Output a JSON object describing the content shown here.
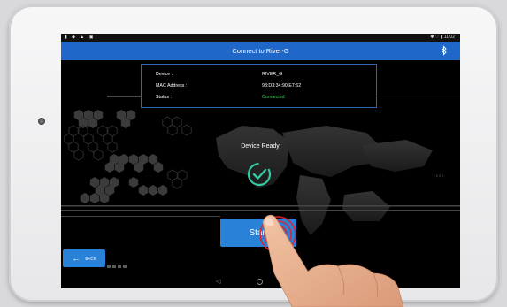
{
  "status_bar": {
    "left_icons": "▮ ◆ ▲ ▣",
    "time": "✱ ♡ ▮ 11:02"
  },
  "app_bar": {
    "title": "Connect to River-G"
  },
  "device_info": {
    "rows": [
      {
        "label": "Device :",
        "value": "RIVER_G"
      },
      {
        "label": "MAC Address :",
        "value": "98:D3:34:90:E7:62"
      },
      {
        "label": "Status :",
        "value": "Connected"
      }
    ]
  },
  "ready": {
    "title": "Device Ready"
  },
  "start_button": {
    "label": "Start"
  },
  "back_button": {
    "label": "BACK"
  },
  "decor": {
    "arrows": "››››"
  },
  "colors": {
    "accent": "#1f67c9",
    "button": "#2a82d8",
    "success": "#3bd35a",
    "check_ring": "#34c9a0"
  },
  "icons": [
    "bluetooth-icon",
    "check-circle-icon",
    "back-arrow-icon",
    "nav-back-icon",
    "nav-home-icon",
    "nav-recent-icon"
  ]
}
